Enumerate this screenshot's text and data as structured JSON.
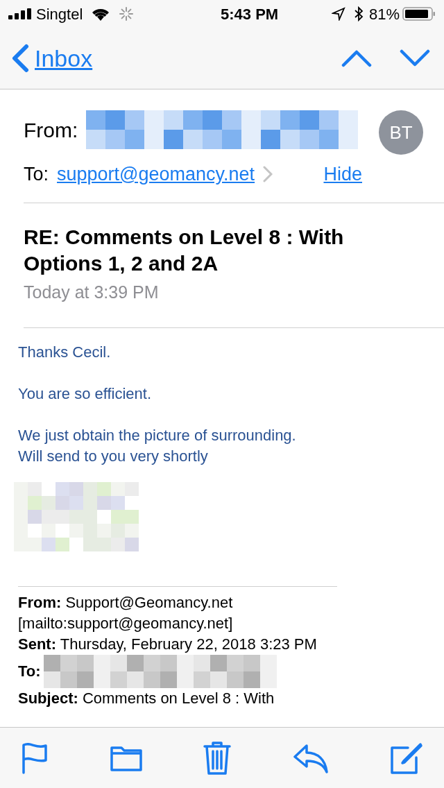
{
  "status_bar": {
    "carrier": "Singtel",
    "time": "5:43 PM",
    "battery": "81%"
  },
  "nav": {
    "back": "Inbox"
  },
  "header": {
    "from_label": "From:",
    "to_label": "To:",
    "to": "support@geomancy.net",
    "hide": "Hide",
    "avatar": "BT",
    "subject": "RE: Comments on Level 8 : With Options 1, 2 and 2A",
    "date": "Today at 3:39 PM"
  },
  "body": [
    "Thanks Cecil.",
    "You are so efficient.",
    "We just obtain the picture of surrounding.\nWill send to you very shortly"
  ],
  "quoted": {
    "from": "**From:** Support@Geomancy.net [mailto:support@geomancy.net]",
    "sent": "**Sent:** Thursday, February 22, 2018 3:23 PM",
    "to_label": "To:",
    "subject": "**Subject:** Comments on Level 8 : With"
  }
}
